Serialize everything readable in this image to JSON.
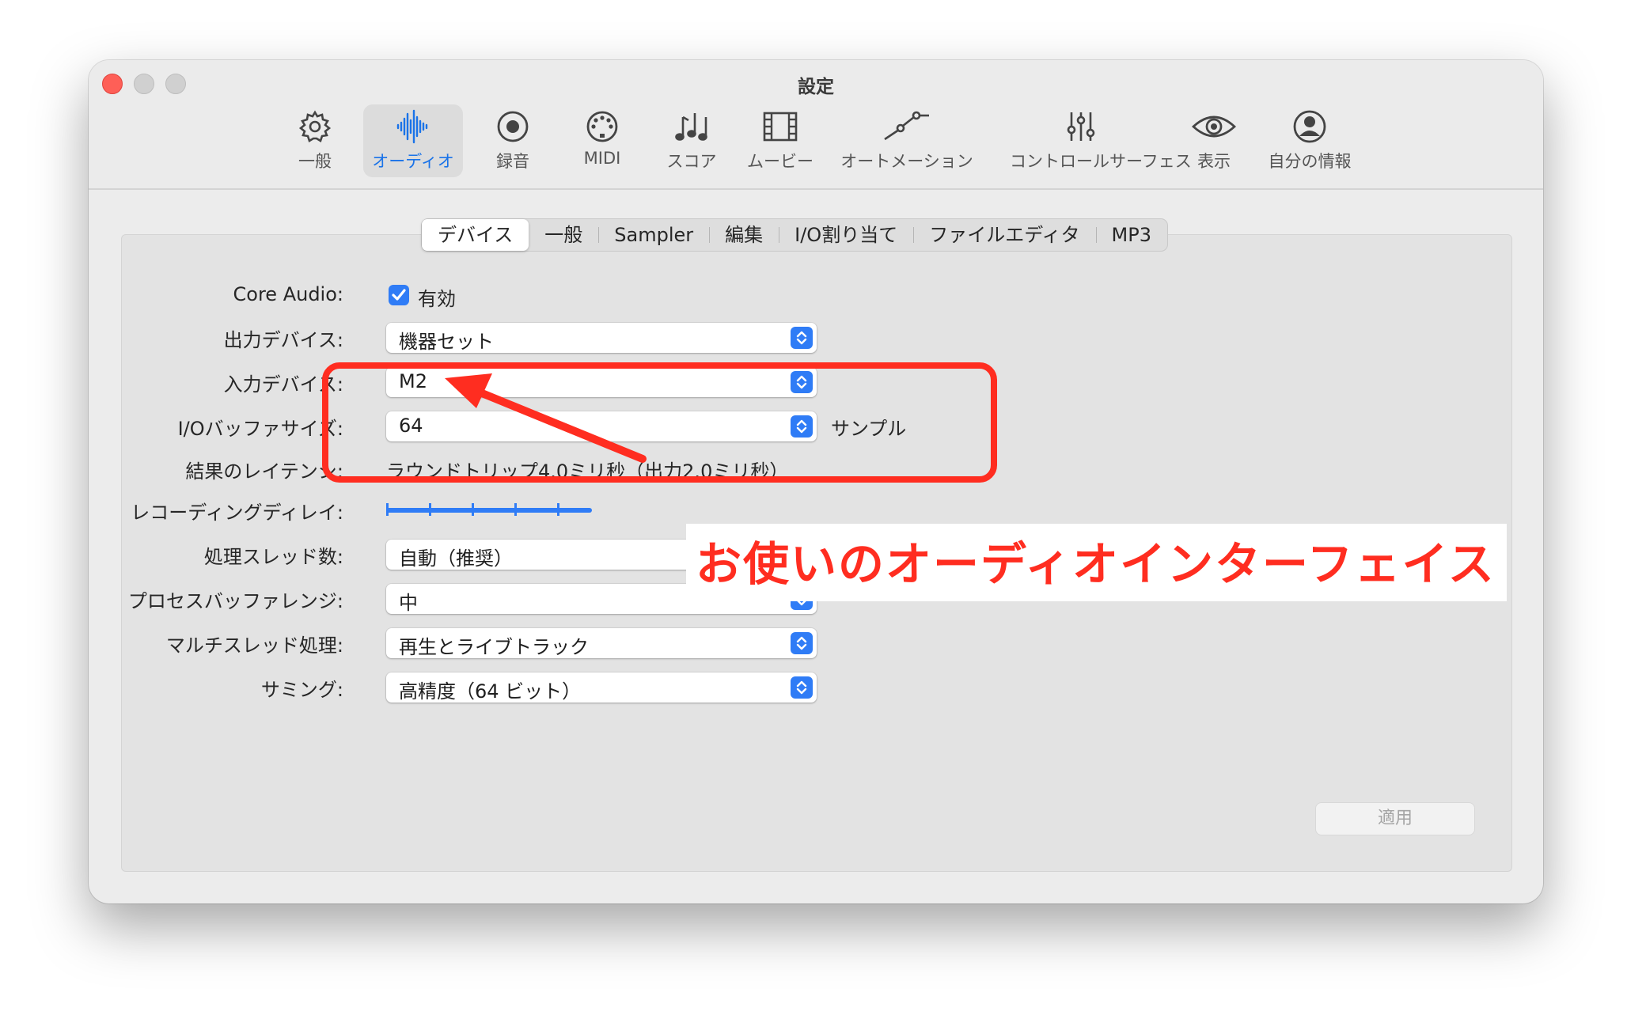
{
  "window": {
    "title": "設定"
  },
  "toolbar": {
    "items": [
      {
        "label": "一般",
        "icon": "gear-icon"
      },
      {
        "label": "オーディオ",
        "icon": "waveform-icon",
        "selected": true
      },
      {
        "label": "録音",
        "icon": "record-icon"
      },
      {
        "label": "MIDI",
        "icon": "midi-connector-icon"
      },
      {
        "label": "スコア",
        "icon": "music-notes-icon"
      },
      {
        "label": "ムービー",
        "icon": "film-icon"
      },
      {
        "label": "オートメーション",
        "icon": "automation-curve-icon"
      },
      {
        "label": "コントロールサーフェス",
        "icon": "faders-icon"
      },
      {
        "label": "表示",
        "icon": "eye-icon"
      },
      {
        "label": "自分の情報",
        "icon": "person-icon"
      }
    ]
  },
  "tabs": {
    "items": [
      "デバイス",
      "一般",
      "Sampler",
      "編集",
      "I/O割り当て",
      "ファイルエディタ",
      "MP3"
    ],
    "active": "デバイス"
  },
  "form": {
    "core_audio": {
      "label": "Core Audio:",
      "checkbox_label": "有効",
      "checked": true
    },
    "output_device": {
      "label": "出力デバイス:",
      "value": "機器セット"
    },
    "input_device": {
      "label": "入力デバイス:",
      "value": "M2"
    },
    "io_buffer": {
      "label": "I/Oバッファサイズ:",
      "value": "64",
      "unit": "サンプル"
    },
    "latency": {
      "label": "結果のレイテンシ:",
      "value": "ラウンドトリップ4.0ミリ秒（出力2.0ミリ秒）"
    },
    "recording_delay": {
      "label": "レコーディングディレイ:"
    },
    "threads": {
      "label": "処理スレッド数:",
      "value": "自動（推奨）"
    },
    "process_buffer": {
      "label": "プロセスバッファレンジ:",
      "value": "中"
    },
    "multithread": {
      "label": "マルチスレッド処理:",
      "value": "再生とライブトラック"
    },
    "summing": {
      "label": "サミング:",
      "value": "高精度（64 ビット）"
    }
  },
  "apply_button": {
    "label": "適用",
    "enabled": false
  },
  "annotation": {
    "text": "お使いのオーディオインターフェイス",
    "color": "#ff2d20"
  }
}
